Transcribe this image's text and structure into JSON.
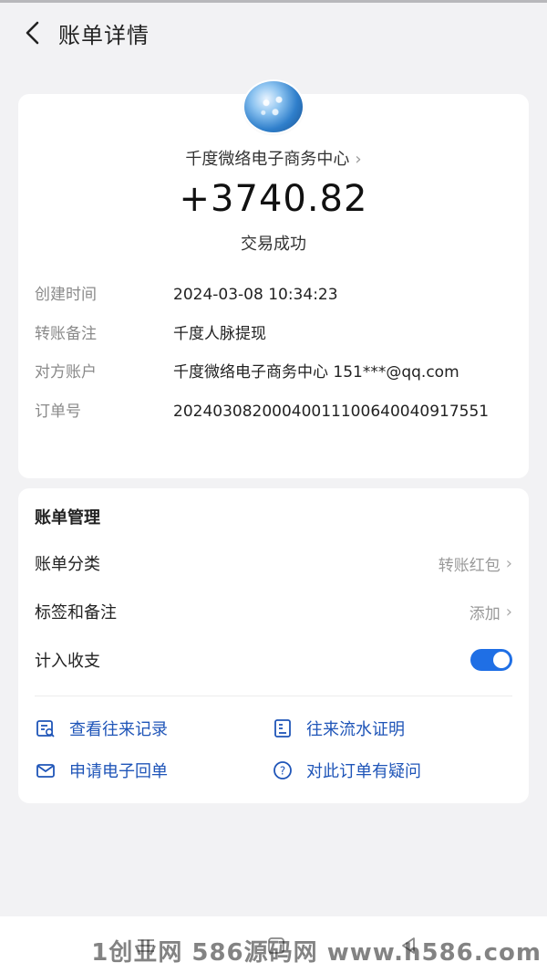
{
  "header": {
    "title": "账单详情"
  },
  "summary": {
    "merchant": "千度微络电子商务中心",
    "amount": "+3740.82",
    "status": "交易成功"
  },
  "details": [
    {
      "label": "创建时间",
      "value": "2024-03-08 10:34:23"
    },
    {
      "label": "转账备注",
      "value": "千度人脉提现"
    },
    {
      "label": "对方账户",
      "value": "千度微络电子商务中心 151***@qq.com"
    },
    {
      "label": "订单号",
      "value": "20240308200040011100640040917551"
    }
  ],
  "manage": {
    "title": "账单管理",
    "category": {
      "label": "账单分类",
      "value": "转账红包"
    },
    "tags": {
      "label": "标签和备注",
      "value": "添加"
    },
    "budget": {
      "label": "计入收支",
      "on": true
    },
    "actions": {
      "view_records": "查看往来记录",
      "flow_proof": "往来流水证明",
      "e_receipt": "申请电子回单",
      "question": "对此订单有疑问"
    }
  },
  "watermark": "1创业网 586源码网 www.h586.com",
  "colors": {
    "accent": "#1f6fe5",
    "link": "#1f55b8",
    "background": "#f2f2f4"
  }
}
